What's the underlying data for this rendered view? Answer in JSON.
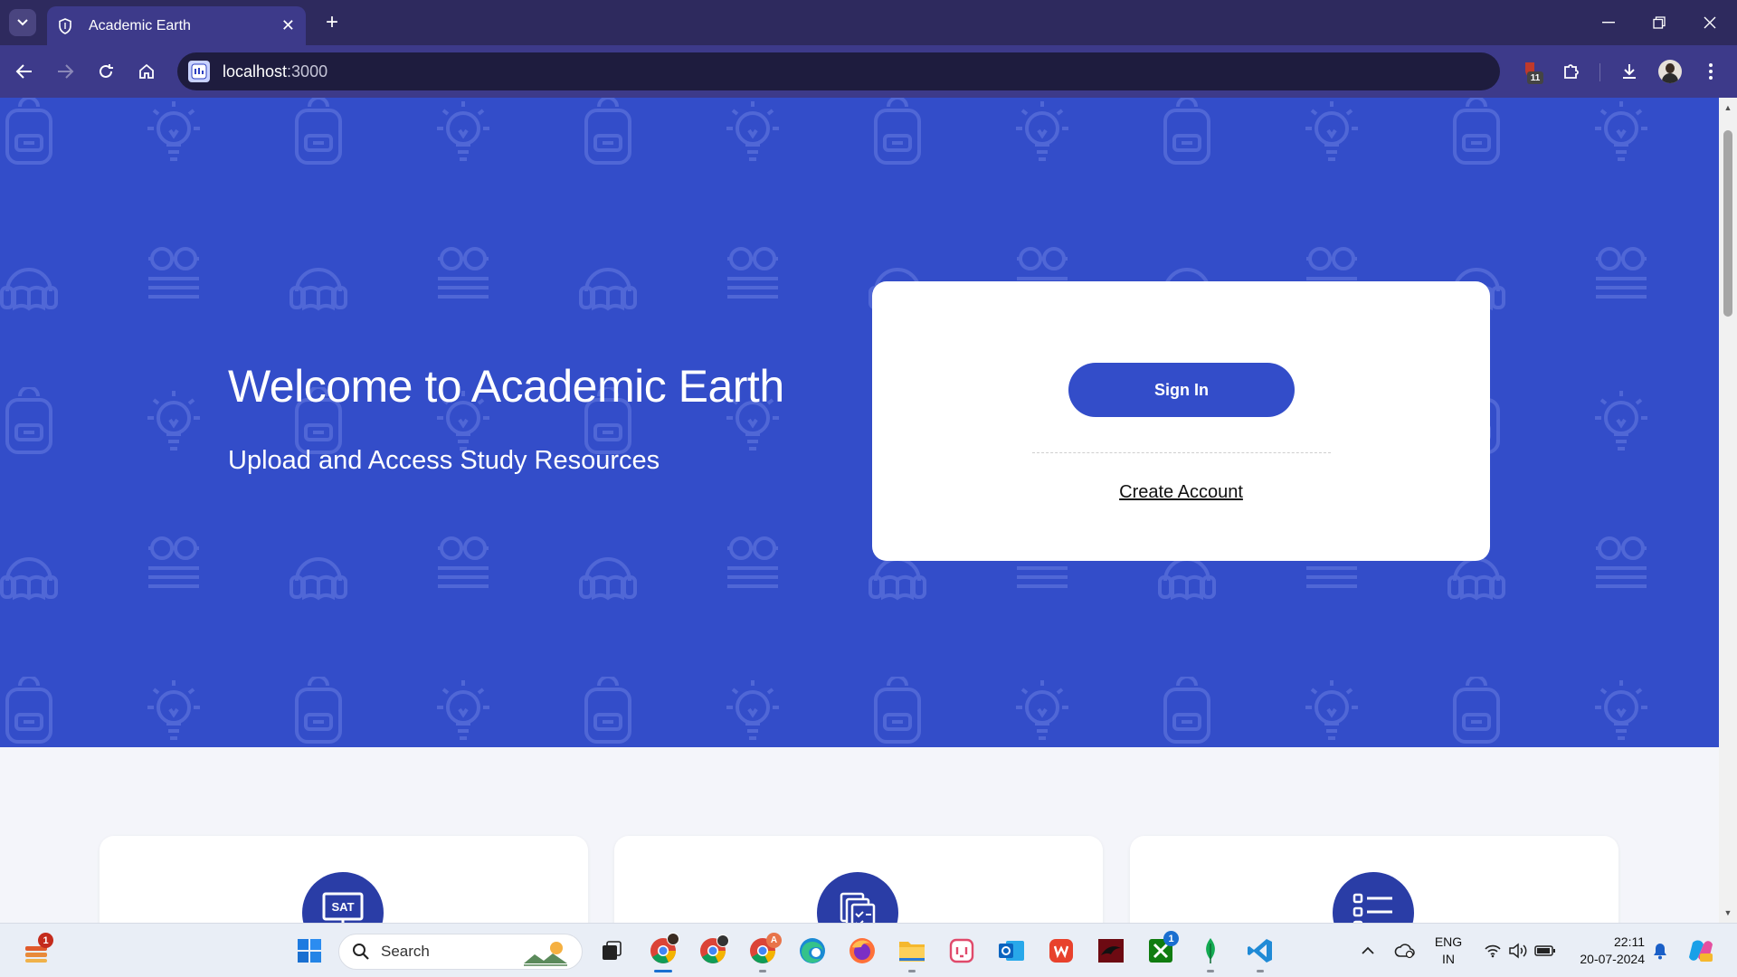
{
  "browser": {
    "tab_title": "Academic Earth",
    "url_host": "localhost",
    "url_port": ":3000",
    "extension_badge": "11"
  },
  "hero": {
    "title": "Welcome to Academic Earth",
    "subtitle": "Upload and Access Study Resources"
  },
  "auth": {
    "sign_in_label": "Sign In",
    "create_account_label": "Create Account"
  },
  "features": [
    {
      "icon": "sat-presentation-icon",
      "icon_text": "SAT"
    },
    {
      "icon": "documents-checklist-icon"
    },
    {
      "icon": "checklist-icon"
    }
  ],
  "taskbar": {
    "search_placeholder": "Search",
    "weather_badge": "1",
    "chrome_profile_badge": "A",
    "xbox_badge": "1",
    "language": "ENG",
    "region": "IN",
    "time": "22:11",
    "date": "20-07-2024"
  },
  "colors": {
    "hero_bg": "#334dc9",
    "accent": "#334dc9",
    "browser_frame": "#2e2a5e"
  }
}
